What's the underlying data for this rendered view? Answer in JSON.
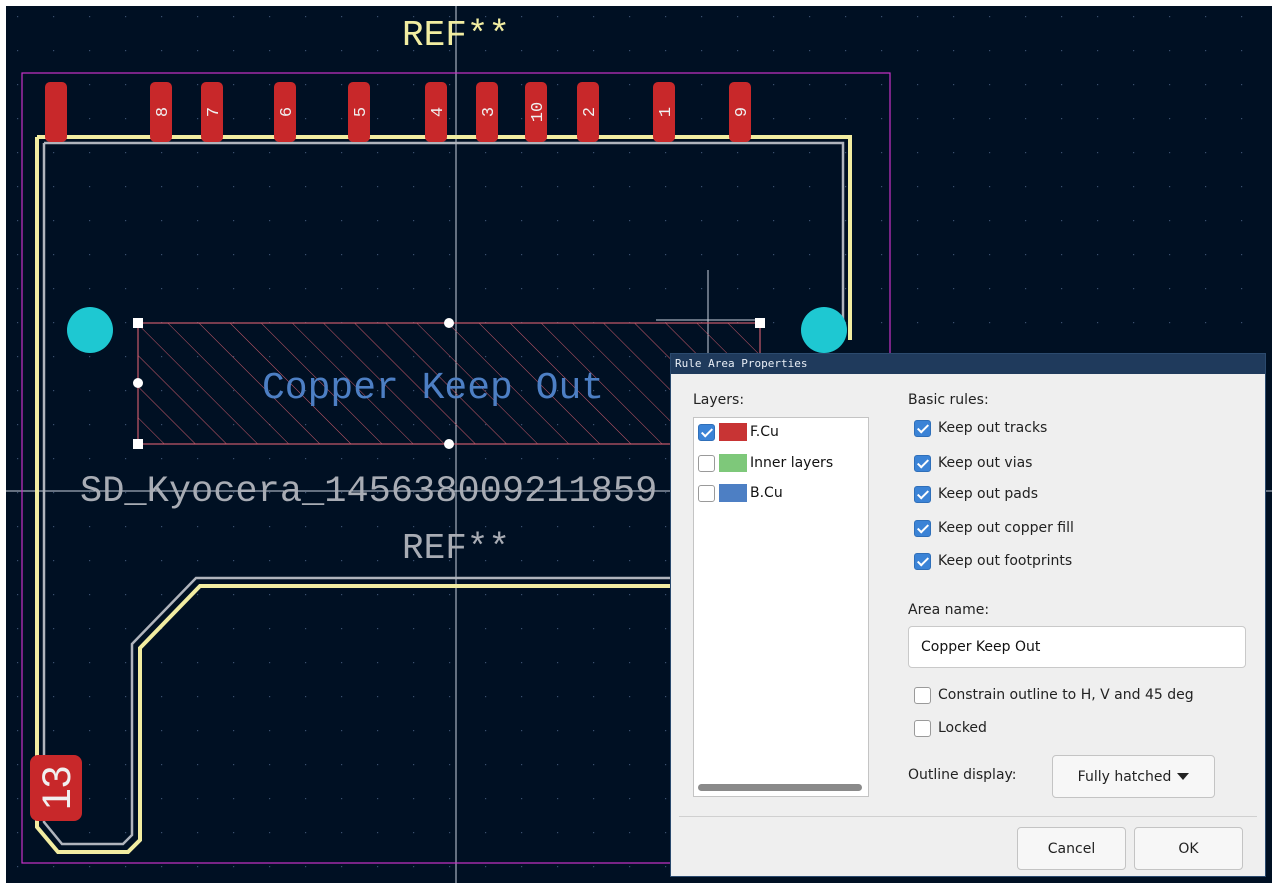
{
  "canvas": {
    "ref_top": "REF**",
    "ref_bottom": "REF**",
    "footprint_value": "SD_Kyocera_145638009211859",
    "zone_label": "Copper Keep Out",
    "pads": [
      "8",
      "7",
      "6",
      "5",
      "4",
      "3",
      "10",
      "2",
      "1",
      "9"
    ],
    "big_pad": "13",
    "colors": {
      "background": "#001023",
      "pad": "#c8282a",
      "silk": "#f2eda1",
      "courtyard": "#c832c8",
      "zone_text": "#4d7fc4",
      "npth": "#1ec8d2"
    }
  },
  "dialog": {
    "title": "Rule Area Properties",
    "layers_label": "Layers:",
    "layers": [
      {
        "name": "F.Cu",
        "checked": true,
        "color": "#c83434"
      },
      {
        "name": "Inner layers",
        "checked": false,
        "color": "#7ec87a"
      },
      {
        "name": "B.Cu",
        "checked": false,
        "color": "#4d7fc4"
      }
    ],
    "basic_rules_label": "Basic rules:",
    "rules": [
      {
        "label": "Keep out tracks",
        "checked": true
      },
      {
        "label": "Keep out vias",
        "checked": true
      },
      {
        "label": "Keep out pads",
        "checked": true
      },
      {
        "label": "Keep out copper fill",
        "checked": true
      },
      {
        "label": "Keep out footprints",
        "checked": true
      }
    ],
    "area_name_label": "Area name:",
    "area_name_value": "Copper Keep Out",
    "constrain_label": "Constrain outline to H, V and 45 deg",
    "constrain_checked": false,
    "locked_label": "Locked",
    "locked_checked": false,
    "outline_display_label": "Outline display:",
    "outline_display_value": "Fully hatched",
    "cancel_label": "Cancel",
    "ok_label": "OK"
  }
}
